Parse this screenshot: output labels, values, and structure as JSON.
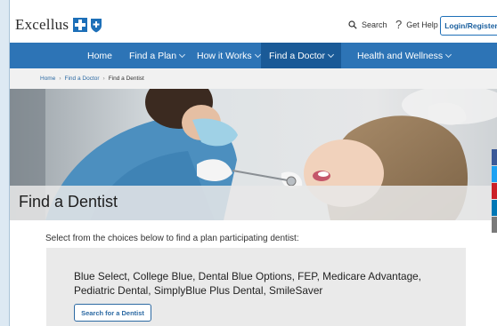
{
  "header": {
    "logo_text": "Excellus",
    "search_label": "Search",
    "help_label": "Get Help",
    "login_label": "Login/Register"
  },
  "nav": {
    "items": [
      {
        "label": "Home"
      },
      {
        "label": "Find a Plan"
      },
      {
        "label": "How it Works"
      },
      {
        "label": "Find a Doctor"
      },
      {
        "label": "Health and Wellness"
      }
    ],
    "active_index": 3
  },
  "breadcrumb": {
    "items": [
      "Home",
      "Find a Doctor",
      "Find a Dentist"
    ],
    "separator": "›"
  },
  "hero": {
    "title": "Find a Dentist"
  },
  "main": {
    "intro": "Select from the choices below to find a plan participating dentist:",
    "card": {
      "plans_text": "Blue Select, College Blue, Dental Blue Options, FEP, Medicare Advantage, Pediatric Dental, SimplyBlue Plus Dental, SmileSaver",
      "button_label": "Search for a Dentist"
    }
  },
  "social": [
    {
      "icon": "facebook-icon",
      "color": "#3b5998"
    },
    {
      "icon": "twitter-icon",
      "color": "#1da1f2"
    },
    {
      "icon": "pinterest-icon",
      "color": "#cb2027"
    },
    {
      "icon": "linkedin-icon",
      "color": "#0077b5"
    },
    {
      "icon": "email-icon",
      "color": "#7a7a7a"
    }
  ],
  "colors": {
    "nav_bg": "#2d74b6",
    "nav_active_bg": "#1a5a97",
    "brand_blue": "#1d6fb8",
    "card_bg": "#eaeaea"
  }
}
